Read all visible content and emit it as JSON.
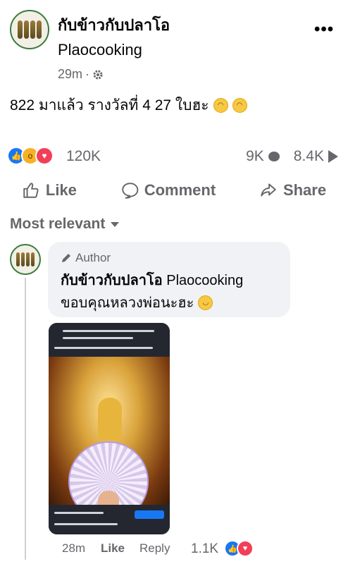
{
  "post": {
    "page_name": "กับข้าวกับปลาโอ",
    "page_handle": "Plaocooking",
    "time": "29m",
    "dot": "·",
    "text": "822 มาแล้ว รางวัลที่ 4 27 ใบฮะ",
    "reaction_count": "120K",
    "comment_count": "9K",
    "share_count": "8.4K"
  },
  "actions": {
    "like": "Like",
    "comment": "Comment",
    "share": "Share"
  },
  "filter": {
    "label": "Most relevant"
  },
  "comment": {
    "author_tag": "Author",
    "name": "กับข้าวกับปลาโอ",
    "handle": "Plaocooking",
    "text": "ขอบคุณหลวงพ่อนะฮะ",
    "time": "28m",
    "like": "Like",
    "reply": "Reply",
    "reaction_count": "1.1K"
  },
  "icons": {
    "avatar": "fish-avatar-icon",
    "settings": "gear-icon",
    "more": "more-horizontal-icon",
    "like": "thumbs-up-icon",
    "comment": "comment-bubble-icon",
    "share": "share-arrow-icon",
    "pencil": "pencil-icon"
  },
  "colors": {
    "like_blue": "#1877f2",
    "love_red": "#f33e58",
    "wow_yellow": "#f7b125",
    "muted": "#65676b"
  }
}
